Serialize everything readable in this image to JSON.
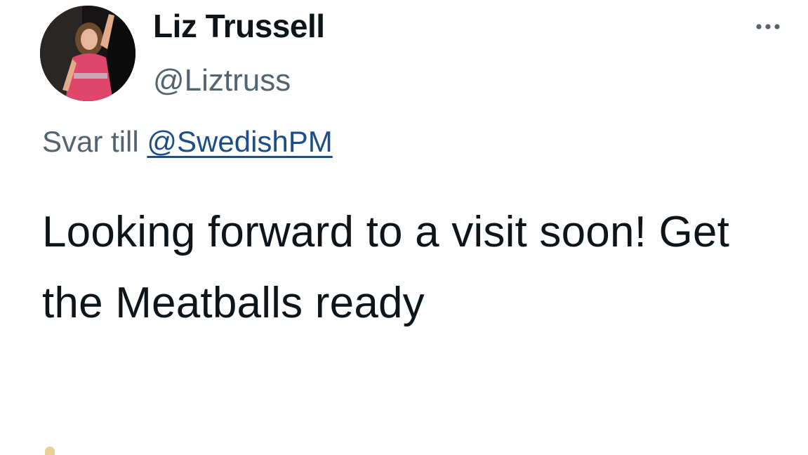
{
  "tweet": {
    "author": {
      "display_name": "Liz Trussell",
      "handle": "@Liztruss",
      "avatar_icon": "profile-photo"
    },
    "more_icon": "more-horizontal-icon",
    "reply": {
      "prefix": "Svar till",
      "mention": "@SwedishPM"
    },
    "text": "Looking forward to a visit soon! Get the Meatballs ready"
  },
  "colors": {
    "text_primary": "#0f1419",
    "text_secondary": "#536471",
    "mention": "#1d4e89",
    "avatar_dress": "#e0466a"
  }
}
